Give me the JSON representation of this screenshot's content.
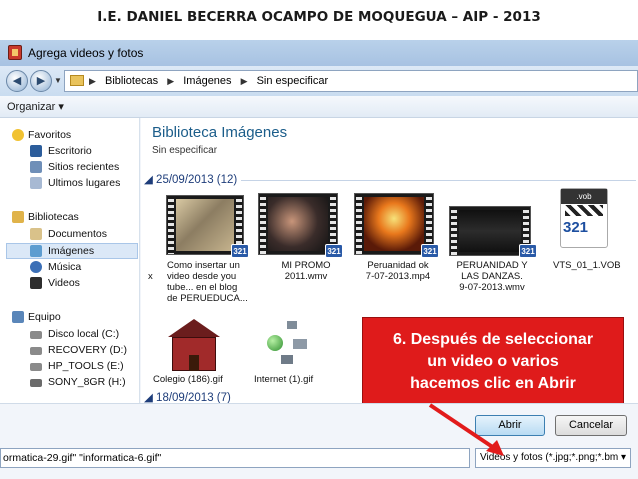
{
  "header": {
    "title": "I.E.  DANIEL BECERRA OCAMPO DE MOQUEGUA – AIP - 2013"
  },
  "window": {
    "title": "Agrega videos y fotos"
  },
  "address": {
    "crumbs": [
      "Bibliotecas",
      "Imágenes",
      "Sin especificar"
    ]
  },
  "toolbar": {
    "organize": "Organizar ▾"
  },
  "nav": {
    "favorites": "Favoritos",
    "favorite_items": [
      "Escritorio",
      "Sitios recientes",
      "Ultimos lugares"
    ],
    "libraries": "Bibliotecas",
    "library_items": [
      "Documentos",
      "Imágenes",
      "Música",
      "Videos"
    ],
    "computer": "Equipo",
    "computer_items": [
      "Disco local (C:)",
      "RECOVERY (D:)",
      "HP_TOOLS (E:)",
      "SONY_8GR (H:)"
    ]
  },
  "library": {
    "title": "Biblioteca Imágenes",
    "subtitle": "Sin especificar"
  },
  "groups": [
    {
      "label": "25/09/2013 (12)"
    },
    {
      "label": "18/09/2013 (7)"
    }
  ],
  "files": [
    {
      "caption": [
        "Como insertar un",
        "video desde  you",
        "tube... en el blog",
        "de PERUEDUCA..."
      ],
      "badge": "321"
    },
    {
      "caption": [
        "MI PROMO",
        "2011.wmv"
      ],
      "badge": "321"
    },
    {
      "caption": [
        "Peruanidad ok",
        "7-07-2013.mp4"
      ],
      "badge": "321"
    },
    {
      "caption": [
        "PERUANIDAD Y",
        "LAS DANZAS.",
        "9-07-2013.wmv"
      ],
      "badge": "321"
    },
    {
      "caption": [
        "VTS_01_1.VOB"
      ],
      "badge": "321",
      "ext": ".vob"
    },
    {
      "caption": [
        "Colegio (186).gif"
      ]
    },
    {
      "caption": [
        "Internet (1).gif"
      ]
    }
  ],
  "cut_letter": "x",
  "callout": {
    "lines": [
      "6. Después de seleccionar",
      "un video  o  varios",
      "hacemos clic en  Abrir"
    ]
  },
  "bottom": {
    "filename": "ormatica-29.gif\" \"informatica-6.gif\"",
    "filter": "Videos y fotos (*.jpg;*.png;*.bm ▾",
    "open": "Abrir",
    "cancel": "Cancelar"
  },
  "colors": {
    "callout": "#df1b1b",
    "arrow": "#e21b1b",
    "group_header": "#1e3d7a",
    "library_title": "#1b5d8a"
  }
}
